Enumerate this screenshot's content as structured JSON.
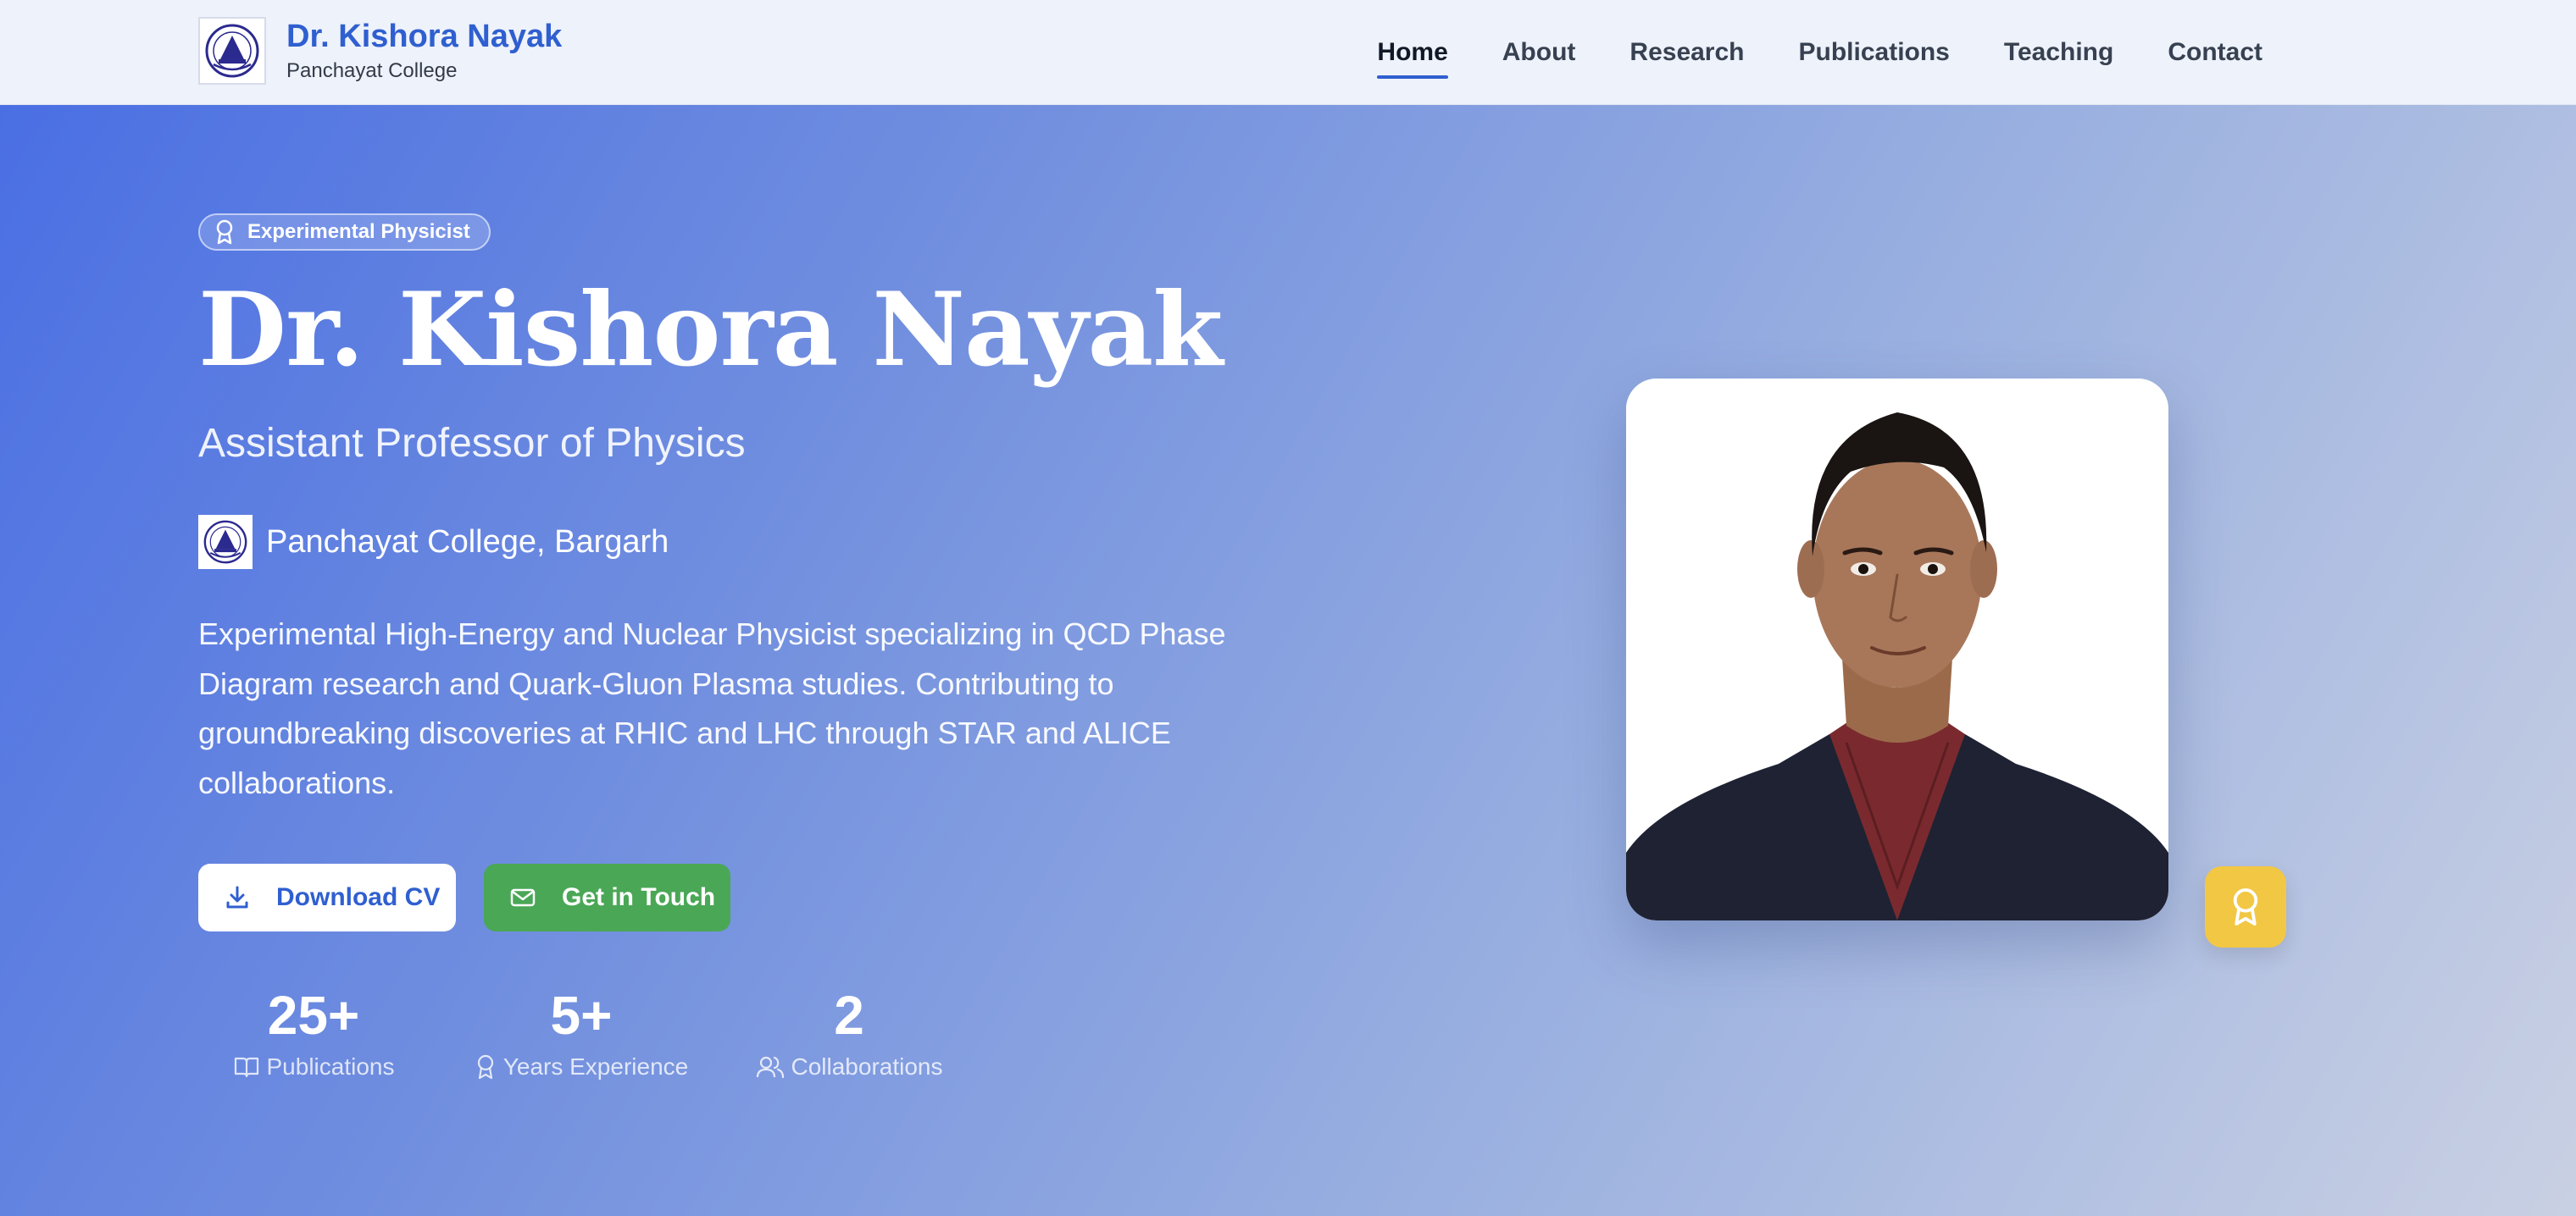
{
  "header": {
    "brand_name": "Dr. Kishora Nayak",
    "brand_sub": "Panchayat College",
    "nav": [
      {
        "label": "Home",
        "active": true
      },
      {
        "label": "About"
      },
      {
        "label": "Research"
      },
      {
        "label": "Publications"
      },
      {
        "label": "Teaching"
      },
      {
        "label": "Contact"
      }
    ]
  },
  "hero": {
    "badge": "Experimental Physicist",
    "title": "Dr. Kishora Nayak",
    "role": "Assistant Professor of Physics",
    "institution": "Panchayat College, Bargarh",
    "description": "Experimental High-Energy and Nuclear Physicist specializing in QCD Phase Diagram research and Quark-Gluon Plasma studies. Contributing to groundbreaking discoveries at RHIC and LHC through STAR and ALICE collaborations.",
    "buttons": {
      "cv": {
        "label": "Download CV",
        "icon": "download-icon"
      },
      "contact": {
        "label": "Get in Touch",
        "icon": "mail-icon"
      }
    },
    "stats": [
      {
        "value": "25+",
        "label": "Publications",
        "icon": "book-icon"
      },
      {
        "value": "5+",
        "label": "Years Experience",
        "icon": "award-icon"
      },
      {
        "value": "2",
        "label": "Collaborations",
        "icon": "users-icon"
      }
    ]
  },
  "colors": {
    "brand": "#2f5fd0",
    "contact_button": "#4aa756",
    "award_badge": "#f2c744",
    "header_bg": "#eef2fa"
  }
}
